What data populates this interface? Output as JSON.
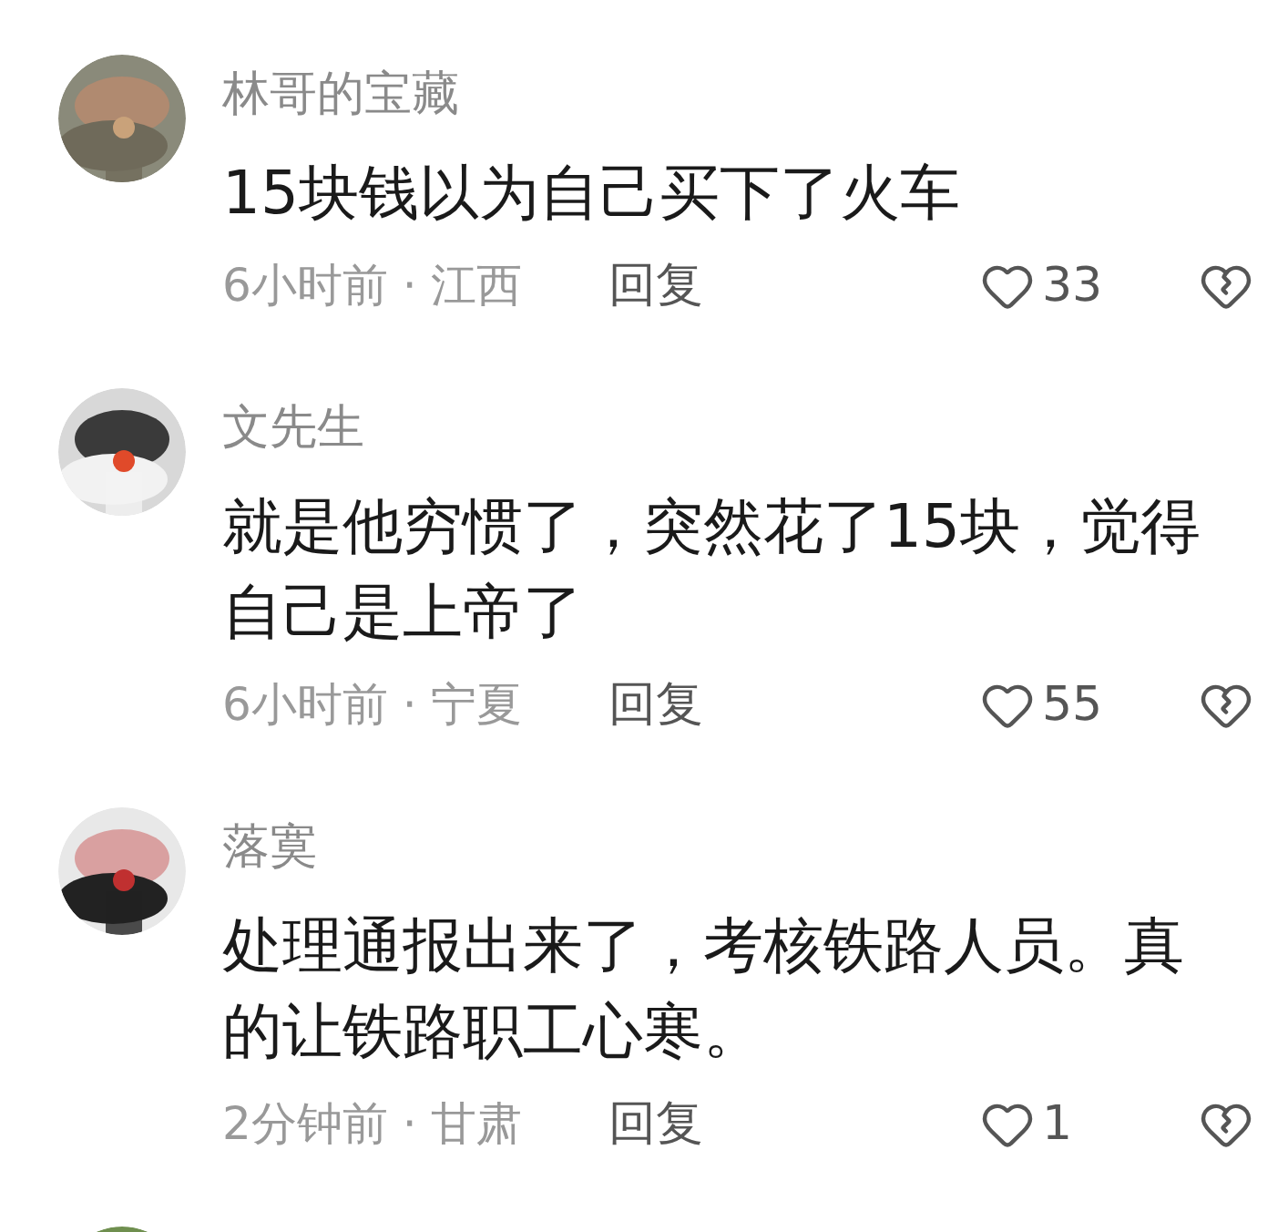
{
  "comments": [
    {
      "avatar": {
        "kind": "picture"
      },
      "name": "林哥的宝藏",
      "text": "15块钱以为自己买下了火车",
      "meta": "6小时前 · 江西",
      "reply": "回复",
      "likes": "33"
    },
    {
      "avatar": {
        "kind": "picture"
      },
      "name": "文先生",
      "text": "就是他穷惯了，突然花了15块，觉得自己是上帝了",
      "meta": "6小时前 · 宁夏",
      "reply": "回复",
      "likes": "55"
    },
    {
      "avatar": {
        "kind": "picture"
      },
      "name": "落寞",
      "text": "处理通报出来了，考核铁路人员。真的让铁路职工心寒。",
      "meta": "2分钟前 · 甘肃",
      "reply": "回复",
      "likes": "1"
    },
    {
      "avatar": {
        "kind": "picture"
      }
    }
  ]
}
